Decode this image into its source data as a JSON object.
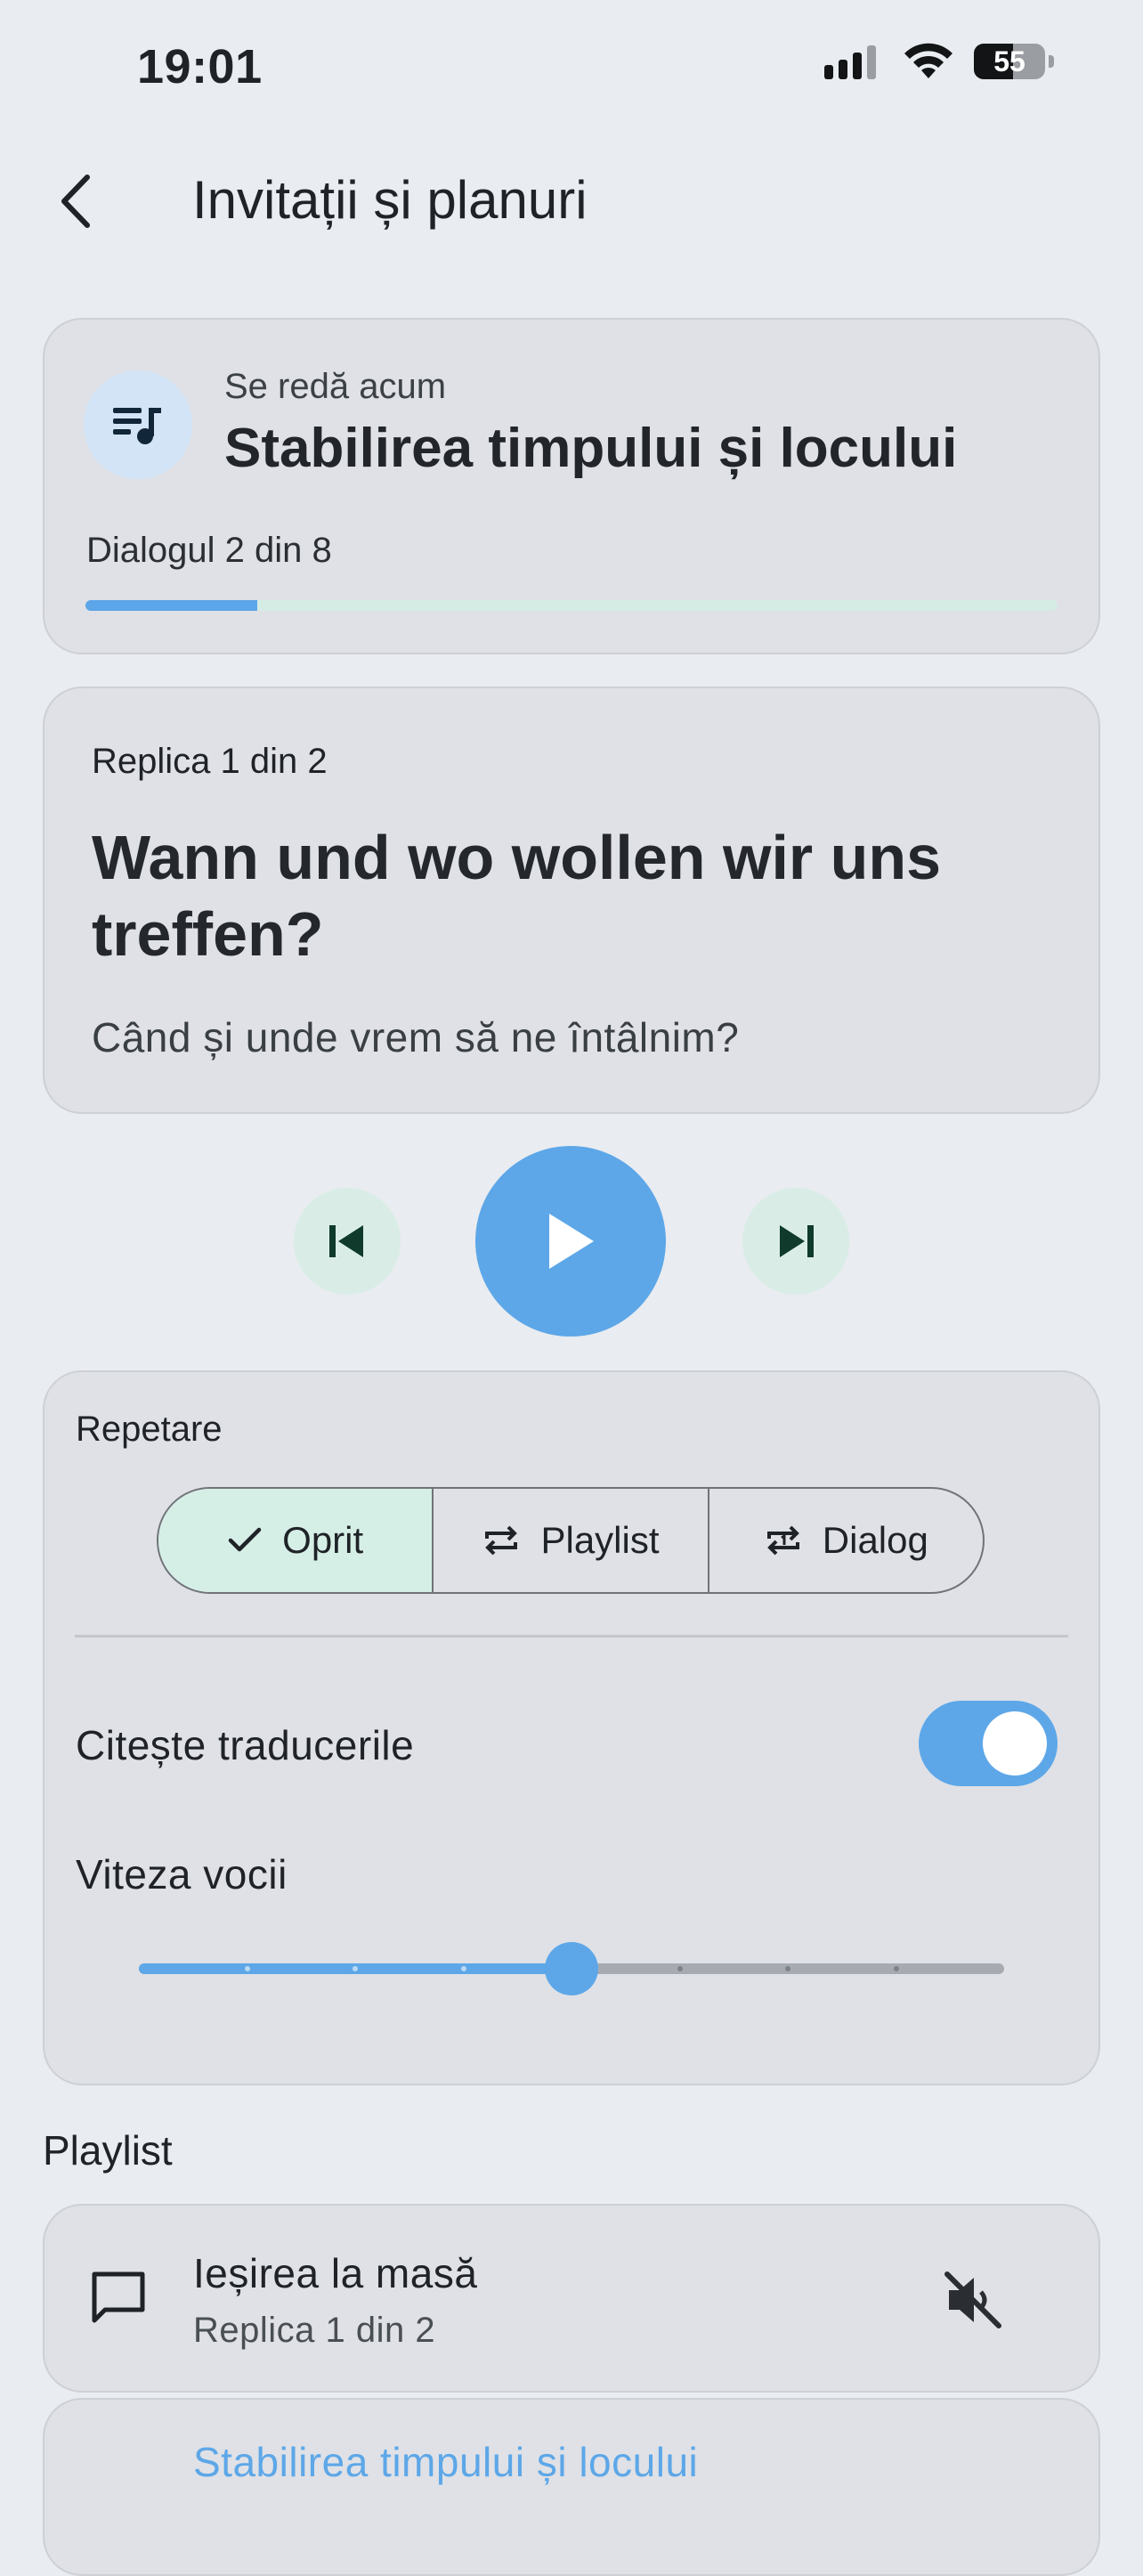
{
  "status_bar": {
    "time": "19:01",
    "battery": "55"
  },
  "header": {
    "title": "Invitații și planuri"
  },
  "now_playing": {
    "label": "Se redă acum",
    "title": "Stabilirea timpului și locului",
    "dialog_count": "Dialogul 2 din 8",
    "progress_fraction": 0.177
  },
  "current_line": {
    "counter": "Replica 1 din 2",
    "german": "Wann und wo wollen wir uns treffen?",
    "romanian": "Când și unde vrem să ne întâlnim?"
  },
  "player": {
    "state": "paused"
  },
  "settings": {
    "repeat_label": "Repetare",
    "repeat_options": [
      {
        "label": "Oprit",
        "selected": true,
        "icon": "check-icon"
      },
      {
        "label": "Playlist",
        "selected": false,
        "icon": "repeat-icon"
      },
      {
        "label": "Dialog",
        "selected": false,
        "icon": "repeat-one-icon"
      }
    ],
    "read_translations_label": "Citește traducerile",
    "read_translations_on": true,
    "speed_label": "Viteza vocii",
    "speed_step": 4,
    "speed_steps_total": 9
  },
  "playlist": {
    "label": "Playlist",
    "items": [
      {
        "title": "Ieșirea la masă",
        "subtitle": "Replica 1 din 2",
        "active": false
      },
      {
        "title": "Stabilirea timpului și locului",
        "subtitle": "",
        "active": true
      }
    ]
  },
  "colors": {
    "accent": "#5da7e8",
    "mint": "#d6efe6",
    "card": "#dfe1e6",
    "background": "#e9ecf0"
  }
}
